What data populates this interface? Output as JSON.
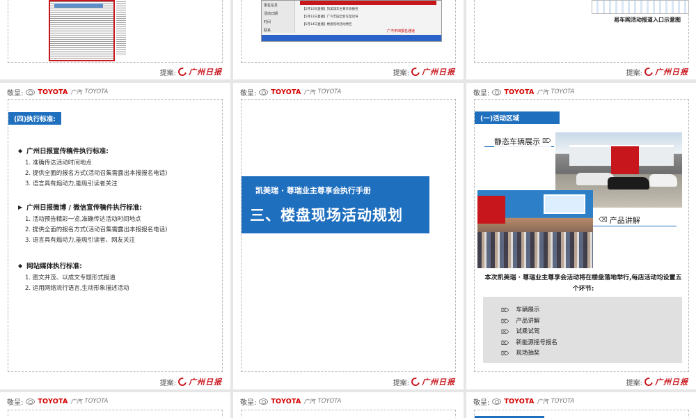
{
  "common": {
    "header_prefix": "敬呈:",
    "toyota_label": "TOYOTA",
    "gac_mark": "广汽",
    "gac_label": "TOYOTA",
    "footer_prefix": "提案:",
    "footer_logo": "广州日报"
  },
  "row0": {
    "web_side_items": [
      "报名信息",
      "活动日期",
      "时间",
      "联系"
    ],
    "web_rows": [
      "【5月10日直播】凯美瑞车主尊享会报名",
      "【5月12日直播】广汽丰田全新车型试驾",
      "【5月14日直播】楼盘现场活动预告"
    ],
    "web_note": "广汽丰田报名通道",
    "caption": "易车网活动报道入口示意图"
  },
  "slide_standards": {
    "tag": "(四)执行标准:",
    "sections": [
      {
        "bullet": "◆",
        "title": "广州日报宣传稿件执行标准:",
        "items": [
          "1. 准确传达活动时间地点",
          "2. 提供全面的报名方式(活动召集需露出本报报名电话)",
          "3. 语言具有煽动力,能吸引读者关注"
        ]
      },
      {
        "bullet": "▶",
        "title": "广州日报微博 / 微信宣传稿件执行标准:",
        "items": [
          "1. 活动预告精彩一览,准确传达活动时间地点",
          "2. 提供全面的报名方式(活动召集需露出本报报名电话)",
          "3. 语言具有煽动力,能吸引读者、网友关注"
        ]
      },
      {
        "bullet": "◆",
        "title": "网站媒体执行标准:",
        "items": [
          "1. 图文并茂、以成文专题形式报道",
          "2. 运用网络流行语言,生动形象描述活动"
        ]
      }
    ]
  },
  "slide_title": {
    "subtitle": "凯美瑞 · 尊瑞业主尊享会执行手册",
    "main": "三、楼盘现场活动规划"
  },
  "slide_activity": {
    "tag": "(一)活动区域",
    "label_static": "静态车辆展示",
    "label_product": "产品讲解",
    "description": "本次凯美瑞 · 尊瑞业主尊享会活动将在楼盘落地举行,每店活动均设置五个环节:",
    "steps": [
      "车辆展示",
      "产品讲解",
      "试乘试驾",
      "新能源摇号报名",
      "现场抽奖"
    ]
  }
}
